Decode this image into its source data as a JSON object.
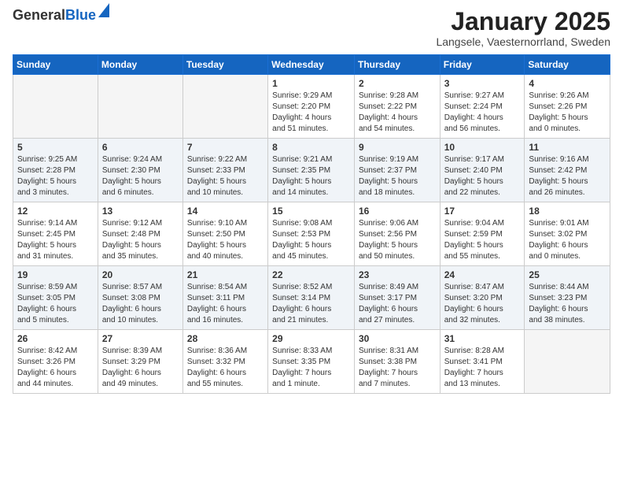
{
  "header": {
    "logo_general": "General",
    "logo_blue": "Blue",
    "main_title": "January 2025",
    "sub_title": "Langsele, Vaesternorrland, Sweden"
  },
  "weekdays": [
    "Sunday",
    "Monday",
    "Tuesday",
    "Wednesday",
    "Thursday",
    "Friday",
    "Saturday"
  ],
  "weeks": [
    [
      {
        "day": "",
        "info": ""
      },
      {
        "day": "",
        "info": ""
      },
      {
        "day": "",
        "info": ""
      },
      {
        "day": "1",
        "info": "Sunrise: 9:29 AM\nSunset: 2:20 PM\nDaylight: 4 hours\nand 51 minutes."
      },
      {
        "day": "2",
        "info": "Sunrise: 9:28 AM\nSunset: 2:22 PM\nDaylight: 4 hours\nand 54 minutes."
      },
      {
        "day": "3",
        "info": "Sunrise: 9:27 AM\nSunset: 2:24 PM\nDaylight: 4 hours\nand 56 minutes."
      },
      {
        "day": "4",
        "info": "Sunrise: 9:26 AM\nSunset: 2:26 PM\nDaylight: 5 hours\nand 0 minutes."
      }
    ],
    [
      {
        "day": "5",
        "info": "Sunrise: 9:25 AM\nSunset: 2:28 PM\nDaylight: 5 hours\nand 3 minutes."
      },
      {
        "day": "6",
        "info": "Sunrise: 9:24 AM\nSunset: 2:30 PM\nDaylight: 5 hours\nand 6 minutes."
      },
      {
        "day": "7",
        "info": "Sunrise: 9:22 AM\nSunset: 2:33 PM\nDaylight: 5 hours\nand 10 minutes."
      },
      {
        "day": "8",
        "info": "Sunrise: 9:21 AM\nSunset: 2:35 PM\nDaylight: 5 hours\nand 14 minutes."
      },
      {
        "day": "9",
        "info": "Sunrise: 9:19 AM\nSunset: 2:37 PM\nDaylight: 5 hours\nand 18 minutes."
      },
      {
        "day": "10",
        "info": "Sunrise: 9:17 AM\nSunset: 2:40 PM\nDaylight: 5 hours\nand 22 minutes."
      },
      {
        "day": "11",
        "info": "Sunrise: 9:16 AM\nSunset: 2:42 PM\nDaylight: 5 hours\nand 26 minutes."
      }
    ],
    [
      {
        "day": "12",
        "info": "Sunrise: 9:14 AM\nSunset: 2:45 PM\nDaylight: 5 hours\nand 31 minutes."
      },
      {
        "day": "13",
        "info": "Sunrise: 9:12 AM\nSunset: 2:48 PM\nDaylight: 5 hours\nand 35 minutes."
      },
      {
        "day": "14",
        "info": "Sunrise: 9:10 AM\nSunset: 2:50 PM\nDaylight: 5 hours\nand 40 minutes."
      },
      {
        "day": "15",
        "info": "Sunrise: 9:08 AM\nSunset: 2:53 PM\nDaylight: 5 hours\nand 45 minutes."
      },
      {
        "day": "16",
        "info": "Sunrise: 9:06 AM\nSunset: 2:56 PM\nDaylight: 5 hours\nand 50 minutes."
      },
      {
        "day": "17",
        "info": "Sunrise: 9:04 AM\nSunset: 2:59 PM\nDaylight: 5 hours\nand 55 minutes."
      },
      {
        "day": "18",
        "info": "Sunrise: 9:01 AM\nSunset: 3:02 PM\nDaylight: 6 hours\nand 0 minutes."
      }
    ],
    [
      {
        "day": "19",
        "info": "Sunrise: 8:59 AM\nSunset: 3:05 PM\nDaylight: 6 hours\nand 5 minutes."
      },
      {
        "day": "20",
        "info": "Sunrise: 8:57 AM\nSunset: 3:08 PM\nDaylight: 6 hours\nand 10 minutes."
      },
      {
        "day": "21",
        "info": "Sunrise: 8:54 AM\nSunset: 3:11 PM\nDaylight: 6 hours\nand 16 minutes."
      },
      {
        "day": "22",
        "info": "Sunrise: 8:52 AM\nSunset: 3:14 PM\nDaylight: 6 hours\nand 21 minutes."
      },
      {
        "day": "23",
        "info": "Sunrise: 8:49 AM\nSunset: 3:17 PM\nDaylight: 6 hours\nand 27 minutes."
      },
      {
        "day": "24",
        "info": "Sunrise: 8:47 AM\nSunset: 3:20 PM\nDaylight: 6 hours\nand 32 minutes."
      },
      {
        "day": "25",
        "info": "Sunrise: 8:44 AM\nSunset: 3:23 PM\nDaylight: 6 hours\nand 38 minutes."
      }
    ],
    [
      {
        "day": "26",
        "info": "Sunrise: 8:42 AM\nSunset: 3:26 PM\nDaylight: 6 hours\nand 44 minutes."
      },
      {
        "day": "27",
        "info": "Sunrise: 8:39 AM\nSunset: 3:29 PM\nDaylight: 6 hours\nand 49 minutes."
      },
      {
        "day": "28",
        "info": "Sunrise: 8:36 AM\nSunset: 3:32 PM\nDaylight: 6 hours\nand 55 minutes."
      },
      {
        "day": "29",
        "info": "Sunrise: 8:33 AM\nSunset: 3:35 PM\nDaylight: 7 hours\nand 1 minute."
      },
      {
        "day": "30",
        "info": "Sunrise: 8:31 AM\nSunset: 3:38 PM\nDaylight: 7 hours\nand 7 minutes."
      },
      {
        "day": "31",
        "info": "Sunrise: 8:28 AM\nSunset: 3:41 PM\nDaylight: 7 hours\nand 13 minutes."
      },
      {
        "day": "",
        "info": ""
      }
    ]
  ]
}
